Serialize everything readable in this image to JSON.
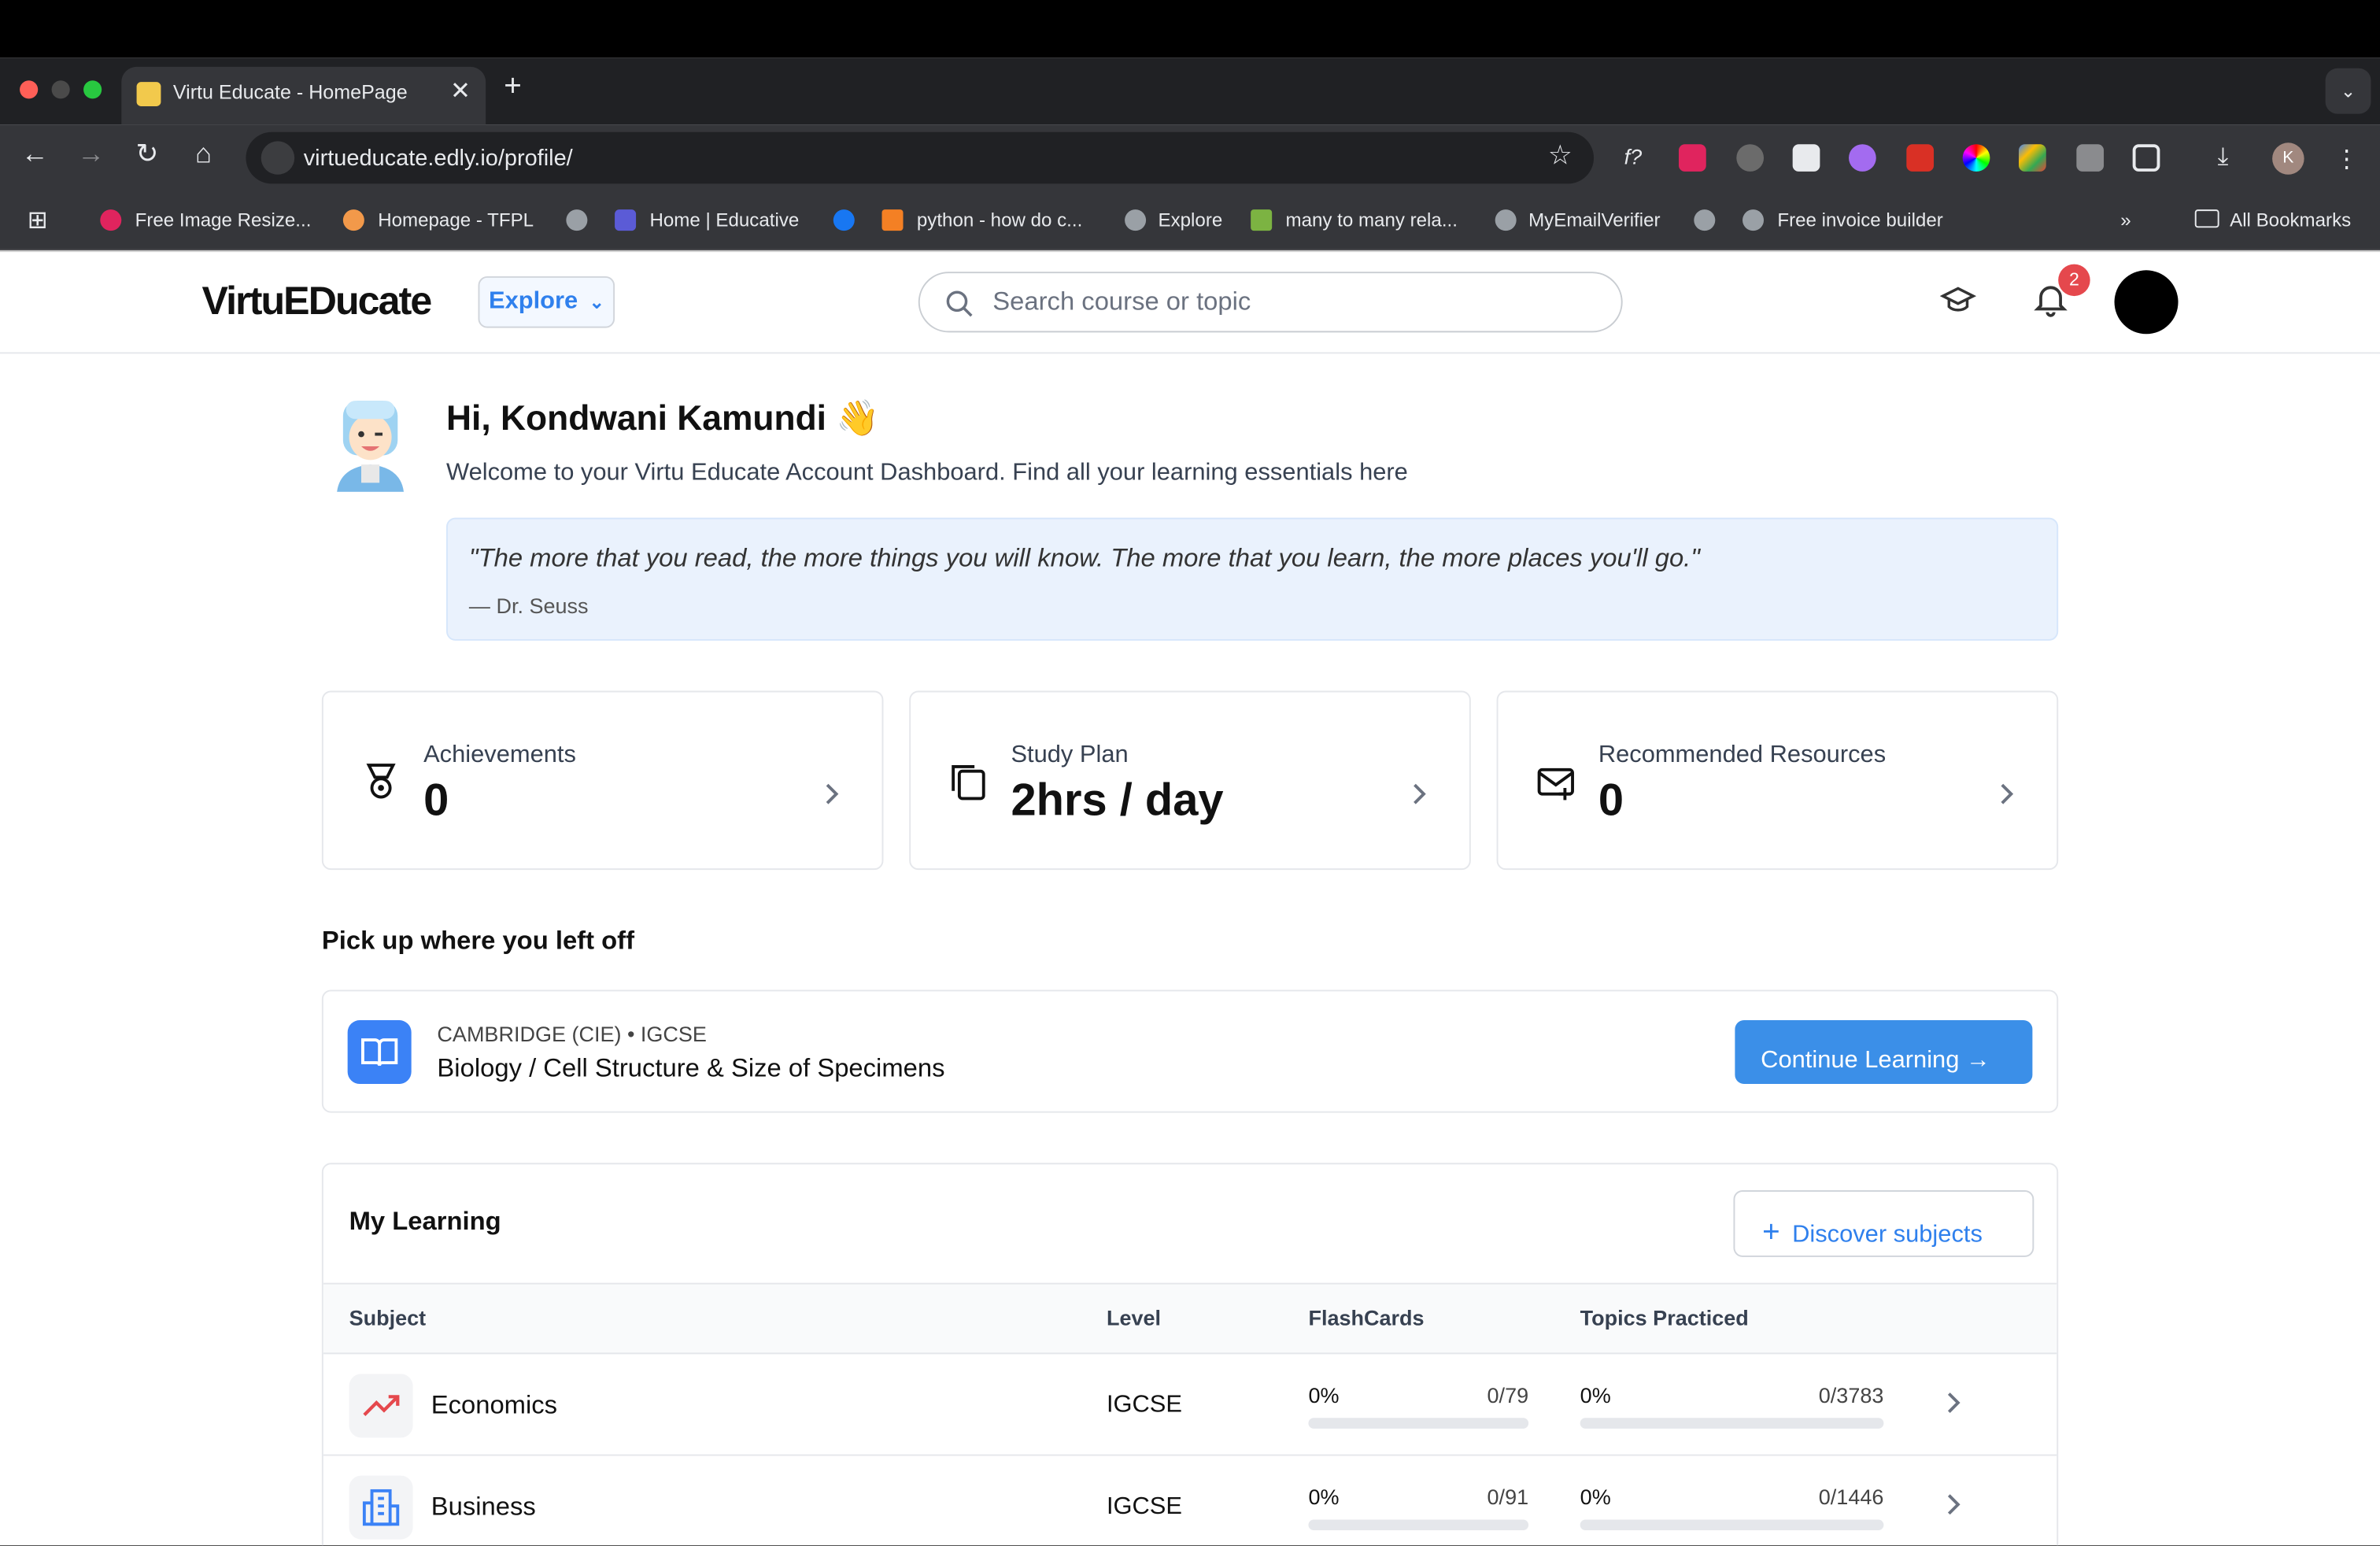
{
  "browser": {
    "tab_title": "Virtu Educate - HomePage",
    "url": "virtueducate.edly.io/profile/",
    "bookmarks": [
      "Free Image Resize...",
      "Homepage - TFPL",
      "Home | Educative",
      "python - how do c...",
      "Explore",
      "many to many rela...",
      "MyEmailVerifier",
      "Free invoice builder"
    ],
    "all_bookmarks": "All Bookmarks",
    "profile_initial": "K"
  },
  "header": {
    "logo": "VirtuEDucate",
    "explore_label": "Explore",
    "search_placeholder": "Search course or topic",
    "notification_count": "2"
  },
  "greeting": {
    "title": "Hi, Kondwani Kamundi 👋",
    "subtitle": "Welcome to your Virtu Educate Account Dashboard. Find all your learning essentials here",
    "quote": "\"The more that you read, the more things you will know. The more that you learn, the more places you'll go.\"",
    "quote_author": "— Dr. Seuss"
  },
  "stats": [
    {
      "label": "Achievements",
      "value": "0",
      "icon": "medal-icon"
    },
    {
      "label": "Study Plan",
      "value": "2hrs / day",
      "icon": "copy-icon"
    },
    {
      "label": "Recommended Resources",
      "value": "0",
      "icon": "mail-plus-icon"
    }
  ],
  "pickup": {
    "heading": "Pick up where you left off",
    "meta": "CAMBRIDGE (CIE) • IGCSE",
    "topic": "Biology / Cell Structure & Size of Specimens",
    "button": "Continue Learning"
  },
  "learning": {
    "heading": "My Learning",
    "discover_button": "Discover subjects",
    "columns": [
      "Subject",
      "Level",
      "FlashCards",
      "Topics Practiced"
    ],
    "rows": [
      {
        "subject": "Economics",
        "level": "IGCSE",
        "flash_pct": "0%",
        "flash_count": "0/79",
        "flash_progress": 0,
        "topics_pct": "0%",
        "topics_count": "0/3783",
        "topics_progress": 0,
        "icon": "trending-up-icon"
      },
      {
        "subject": "Business",
        "level": "IGCSE",
        "flash_pct": "0%",
        "flash_count": "0/91",
        "flash_progress": 0,
        "topics_pct": "0%",
        "topics_count": "0/1446",
        "topics_progress": 0,
        "icon": "building-icon"
      }
    ]
  },
  "colors": {
    "accent": "#3b8fe8",
    "quote_bg": "#eaf2fd",
    "badge": "#e5484d"
  }
}
